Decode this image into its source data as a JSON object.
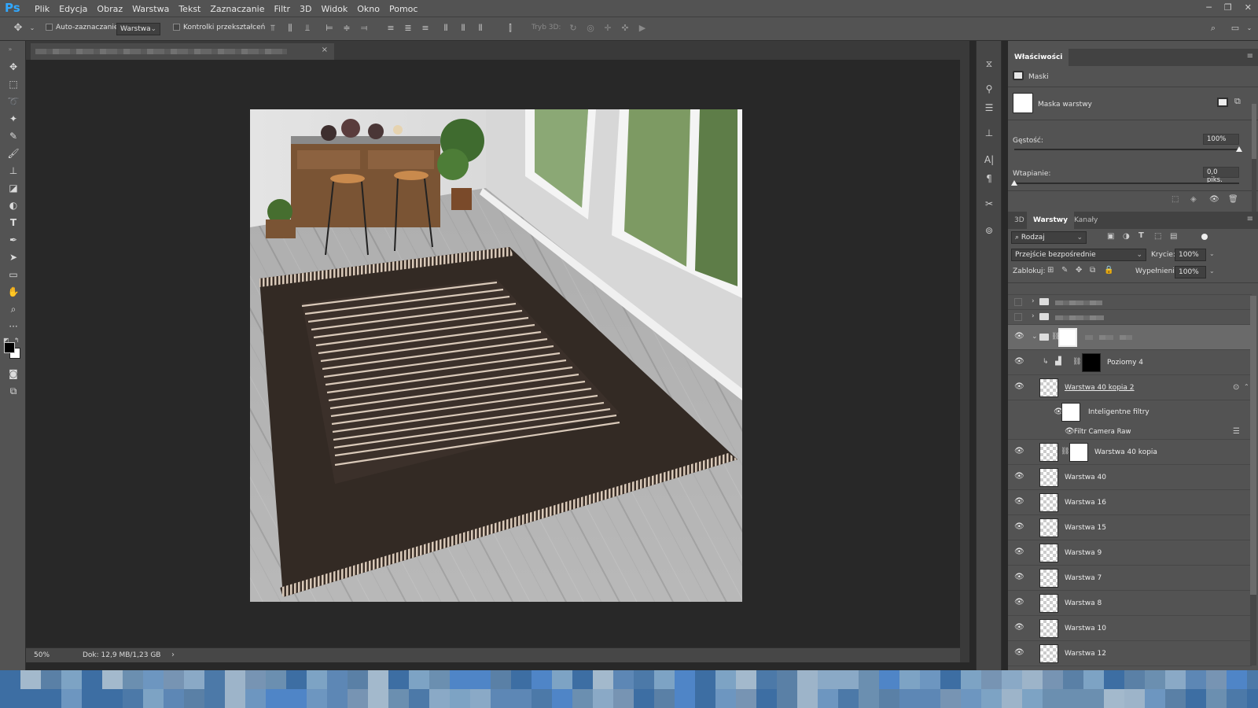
{
  "app": {
    "logo": "Ps"
  },
  "menu": [
    "Plik",
    "Edycja",
    "Obraz",
    "Warstwa",
    "Tekst",
    "Zaznaczanie",
    "Filtr",
    "3D",
    "Widok",
    "Okno",
    "Pomoc"
  ],
  "options": {
    "auto_select_label": "Auto-zaznaczanie:",
    "auto_select_value": "Warstwa",
    "transform_controls_label": "Kontrolki przekształceń",
    "mode3d_label": "Tryb 3D:"
  },
  "status": {
    "zoom": "50%",
    "doc_info": "Dok: 12,9 MB/1,23 GB"
  },
  "properties": {
    "tabs": [
      "Właściwości"
    ],
    "section": "Maski",
    "mask_label": "Maska warstwy",
    "density_label": "Gęstość:",
    "density_value": "100%",
    "density_fraction": 1.0,
    "feather_label": "Wtapianie:",
    "feather_value": "0,0 piks.",
    "feather_fraction": 0.0
  },
  "layers_panel": {
    "tabs": [
      "3D",
      "Warstwy",
      "Kanały"
    ],
    "active_tab": "Warstwy",
    "filter_kind": "Rodzaj",
    "blend_mode": "Przejście bezpośrednie",
    "opacity_label": "Krycie:",
    "opacity_value": "100%",
    "lock_label": "Zablokuj:",
    "fill_label": "Wypełnienie:",
    "fill_value": "100%",
    "levels_layer": "Poziomy 4",
    "smart_layer": "Warstwa 40 kopia 2",
    "smart_filters": "Inteligentne filtry",
    "camera_raw": "Filtr Camera Raw",
    "layers": [
      "Warstwa 40 kopia",
      "Warstwa 40",
      "Warstwa 16",
      "Warstwa 15",
      "Warstwa 9",
      "Warstwa 7",
      "Warstwa 8",
      "Warstwa 10",
      "Warstwa 12"
    ]
  },
  "colors": {
    "ps_blue": "#31a8ff",
    "panel": "#535353",
    "canvas_bg": "#282828"
  }
}
